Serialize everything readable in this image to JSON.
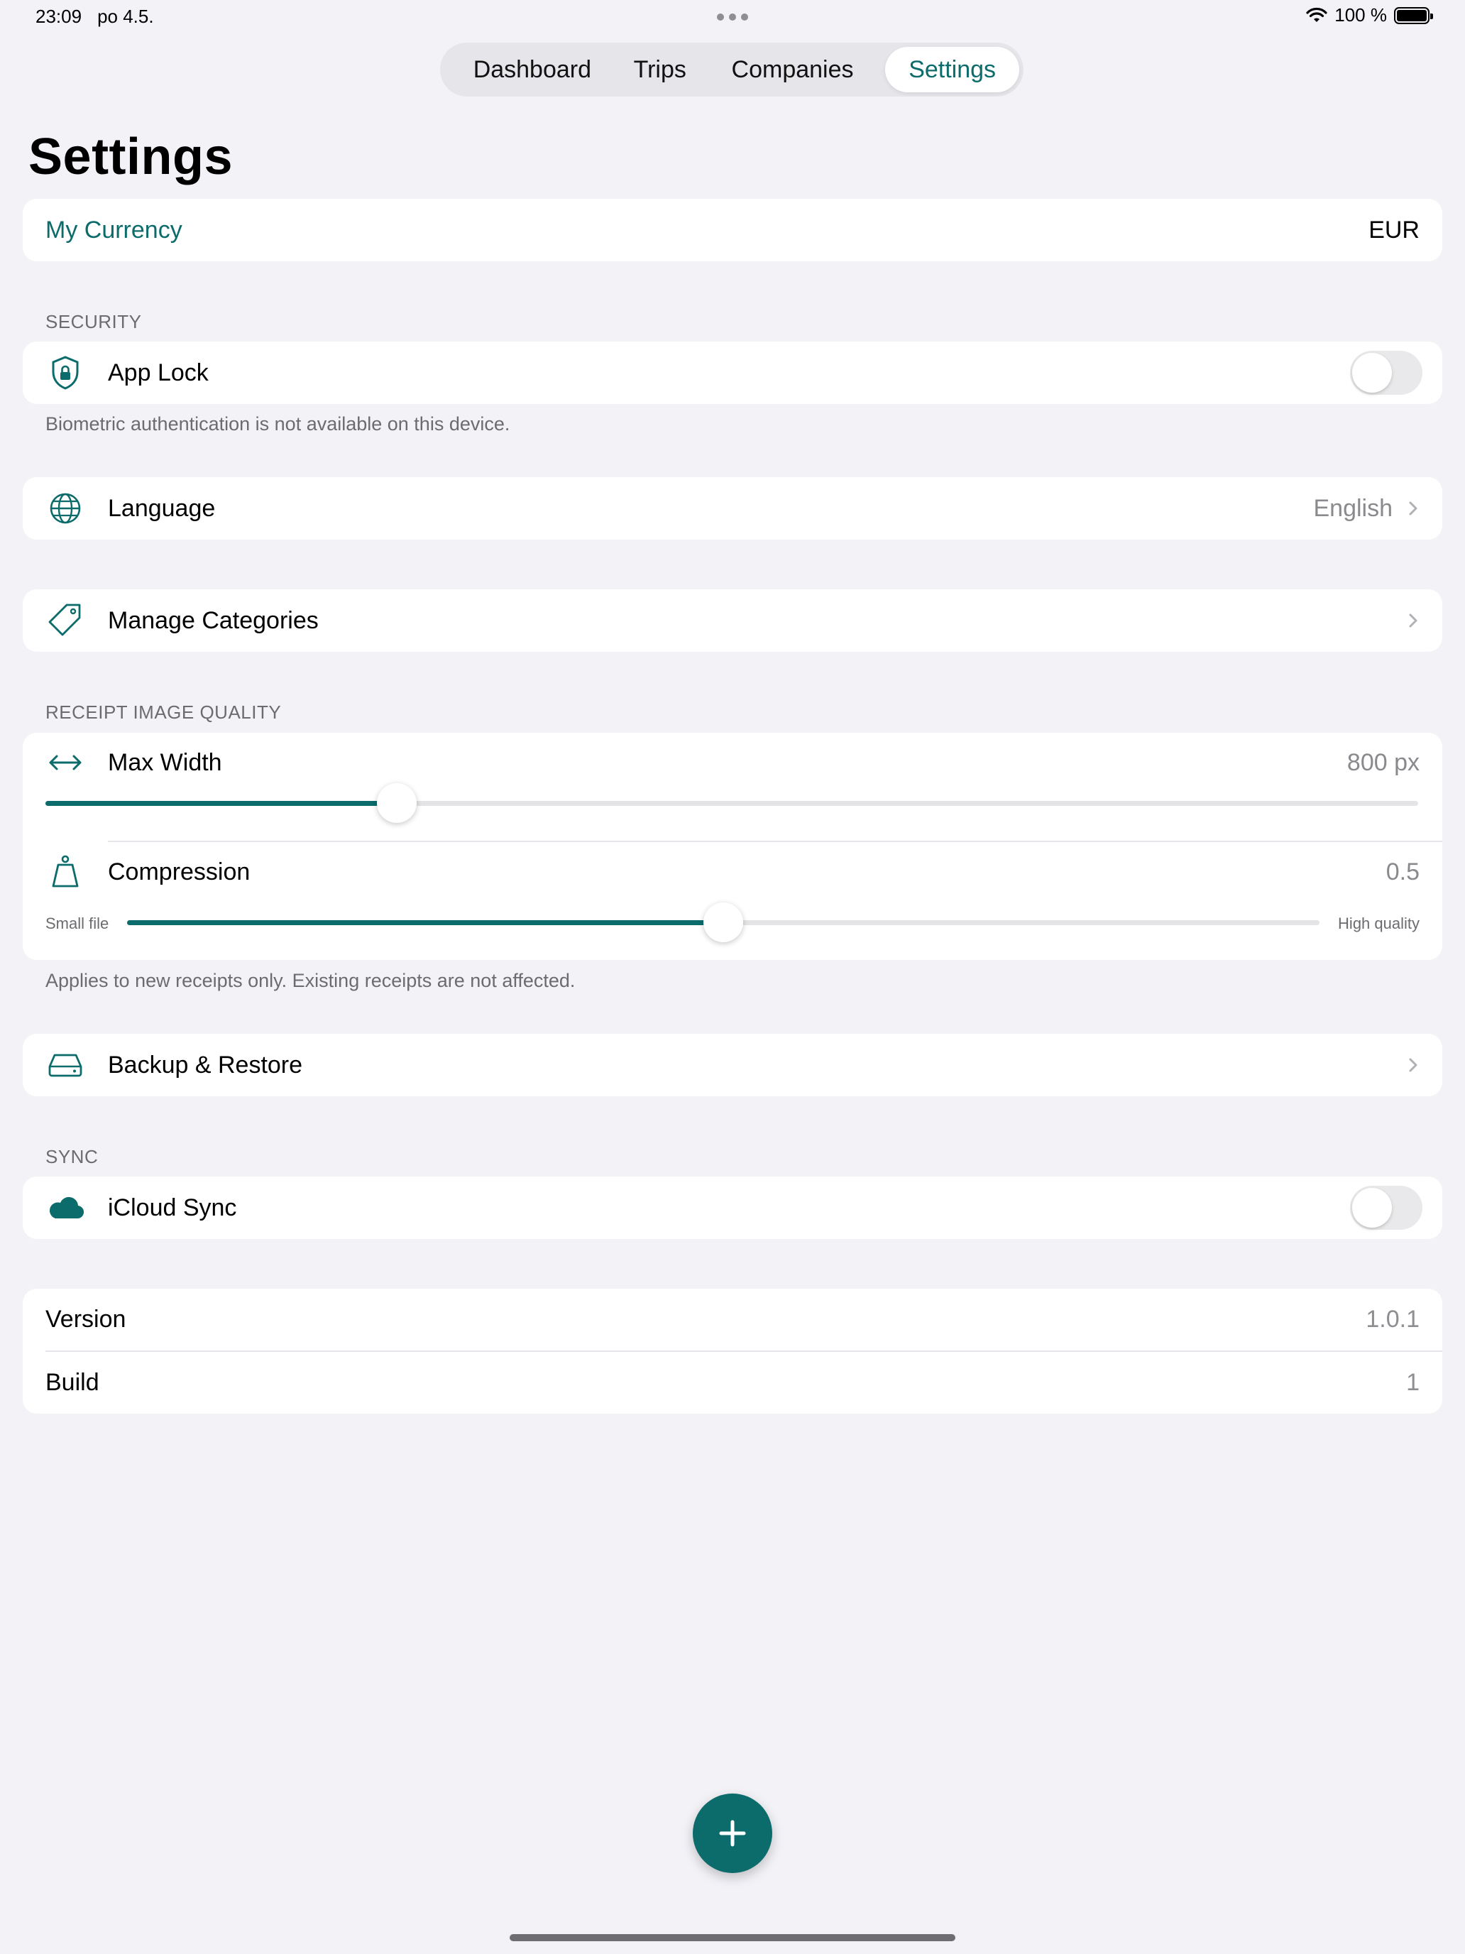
{
  "status_bar": {
    "time": "23:09",
    "date": "po 4.5.",
    "battery": "100 %"
  },
  "tabs": [
    {
      "label": "Dashboard",
      "selected": false
    },
    {
      "label": "Trips",
      "selected": false
    },
    {
      "label": "Companies",
      "selected": false
    },
    {
      "label": "Settings",
      "selected": true
    }
  ],
  "page_title": "Settings",
  "currency": {
    "label": "My Currency",
    "value": "EUR"
  },
  "security": {
    "header": "SECURITY",
    "app_lock": {
      "icon": "lock-shield-icon",
      "label": "App Lock",
      "enabled": false
    },
    "footnote": "Biometric authentication is not available on this device."
  },
  "language": {
    "icon": "globe-icon",
    "label": "Language",
    "value": "English"
  },
  "categories": {
    "icon": "tag-icon",
    "label": "Manage Categories"
  },
  "receipt_quality": {
    "header": "RECEIPT IMAGE QUALITY",
    "max_width": {
      "icon": "width-arrows-icon",
      "label": "Max Width",
      "value": "800 px",
      "slider_fraction": 0.256
    },
    "compression": {
      "icon": "weight-icon",
      "label": "Compression",
      "value": "0.5",
      "min_label": "Small file",
      "max_label": "High quality",
      "slider_fraction": 0.5
    },
    "footnote": "Applies to new receipts only. Existing receipts are not affected."
  },
  "backup": {
    "icon": "drive-icon",
    "label": "Backup & Restore"
  },
  "sync": {
    "header": "SYNC",
    "icloud": {
      "icon": "cloud-icon",
      "label": "iCloud Sync",
      "enabled": false
    }
  },
  "about": [
    {
      "label": "Version",
      "value": "1.0.1"
    },
    {
      "label": "Build",
      "value": "1"
    }
  ],
  "accent_color": "#0c6b6b"
}
